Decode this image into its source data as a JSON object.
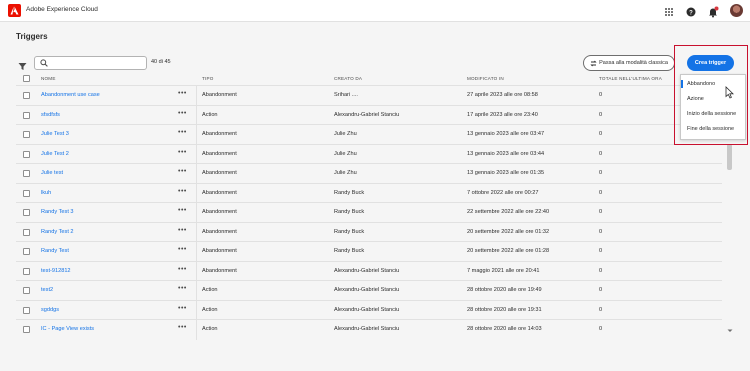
{
  "app": {
    "title": "Adobe Experience Cloud"
  },
  "page": {
    "title": "Triggers"
  },
  "toolbar": {
    "search_value": "",
    "search_placeholder": "",
    "count": "40 di 45",
    "classic_label": "Passa alla modalità classica",
    "create_label": "Crea trigger"
  },
  "table": {
    "headers": {
      "name": "NOME",
      "type": "TIPO",
      "created_by": "CREATO DA",
      "modified": "MODIFICATO IN",
      "total": "TOTALE NELL'ULTIMA ORA"
    },
    "rows": [
      {
        "name": "Abandonment use case",
        "type": "Abandonment",
        "created_by": "Srihari ....",
        "modified": "27 aprile 2023 alle ore 08:58",
        "total": "0"
      },
      {
        "name": "sfsdfsfs",
        "type": "Action",
        "created_by": "Alexandru-Gabriel Stanciu",
        "modified": "17 aprile 2023 alle ore 23:40",
        "total": "0"
      },
      {
        "name": "Julie Test 3",
        "type": "Abandonment",
        "created_by": "Julie Zhu",
        "modified": "13 gennaio 2023 alle ore 03:47",
        "total": "0"
      },
      {
        "name": "Julie Test 2",
        "type": "Abandonment",
        "created_by": "Julie Zhu",
        "modified": "13 gennaio 2023 alle ore 03:44",
        "total": "0"
      },
      {
        "name": "Julie test",
        "type": "Abandonment",
        "created_by": "Julie Zhu",
        "modified": "13 gennaio 2023 alle ore 01:35",
        "total": "0"
      },
      {
        "name": "lkuh",
        "type": "Abandonment",
        "created_by": "Randy Buck",
        "modified": "7 ottobre 2022 alle ore 00:27",
        "total": "0"
      },
      {
        "name": "Randy Test 3",
        "type": "Abandonment",
        "created_by": "Randy Buck",
        "modified": "22 settembre 2022 alle ore 22:40",
        "total": "0"
      },
      {
        "name": "Randy Test 2",
        "type": "Abandonment",
        "created_by": "Randy Buck",
        "modified": "20 settembre 2022 alle ore 01:32",
        "total": "0"
      },
      {
        "name": "Randy Test",
        "type": "Abandonment",
        "created_by": "Randy Buck",
        "modified": "20 settembre 2022 alle ore 01:28",
        "total": "0"
      },
      {
        "name": "test-912812",
        "type": "Abandonment",
        "created_by": "Alexandru-Gabriel Stanciu",
        "modified": "7 maggio 2021 alle ore 20:41",
        "total": "0"
      },
      {
        "name": "test2",
        "type": "Action",
        "created_by": "Alexandru-Gabriel Stanciu",
        "modified": "28 ottobre 2020 alle ore 19:49",
        "total": "0"
      },
      {
        "name": "sgddgs",
        "type": "Action",
        "created_by": "Alexandru-Gabriel Stanciu",
        "modified": "28 ottobre 2020 alle ore 19:31",
        "total": "0"
      },
      {
        "name": "IC - Page View exists",
        "type": "Action",
        "created_by": "Alexandru-Gabriel Stanciu",
        "modified": "28 ottobre 2020 alle ore 14:03",
        "total": "0"
      }
    ]
  },
  "menu": {
    "items": [
      "Abbandono",
      "Azione",
      "Inizio della sessione",
      "Fine della sessione"
    ]
  },
  "icons": {
    "logo": "adobe-logo-icon",
    "apps": "apps-grid-icon",
    "help": "help-icon",
    "notifications": "bell-icon",
    "filter": "filter-icon",
    "search": "search-icon",
    "more": "more-icon"
  },
  "colors": {
    "accent": "#1473e6",
    "brand": "#eb1000",
    "highlight": "#c8102e"
  }
}
